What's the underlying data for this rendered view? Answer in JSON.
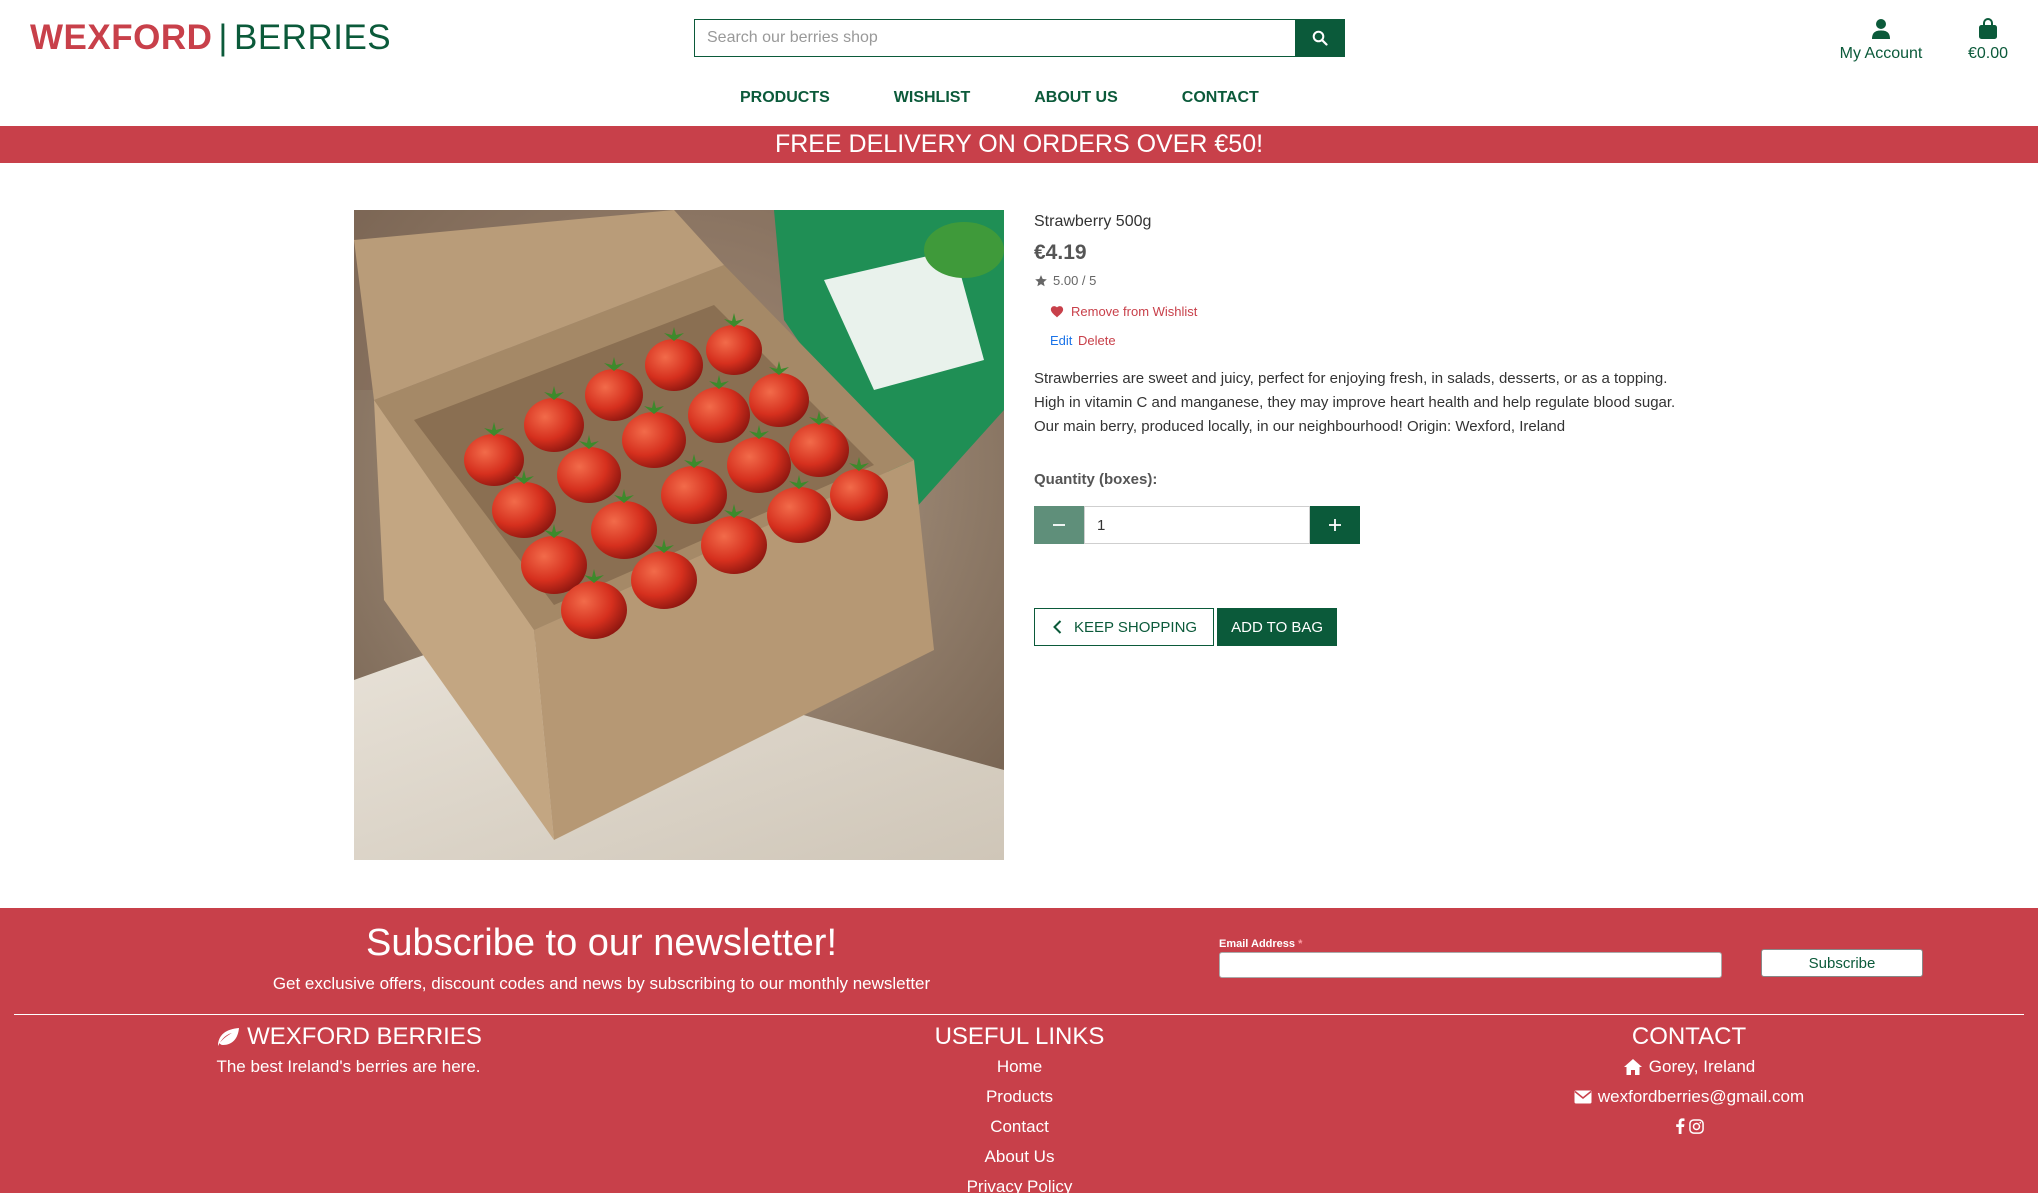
{
  "brand": {
    "name_part1": "WEXFORD",
    "separator": "|",
    "name_part2": "BERRIES",
    "accent_red": "#c8404a",
    "accent_green": "#0b5a3a"
  },
  "search": {
    "placeholder": "Search our berries shop",
    "icon": "search-icon"
  },
  "header": {
    "account_label": "My Account",
    "account_icon": "user-icon",
    "bag_total": "€0.00",
    "bag_icon": "shopping-bag-icon"
  },
  "nav": {
    "items": [
      "PRODUCTS",
      "WISHLIST",
      "ABOUT US",
      "CONTACT"
    ]
  },
  "banner": {
    "text": "FREE DELIVERY ON ORDERS OVER €50!"
  },
  "product": {
    "name": "Strawberry 500g",
    "price": "€4.19",
    "rating": "5.00 / 5",
    "wishlist_label": "Remove from Wishlist",
    "edit_label": "Edit",
    "delete_label": "Delete",
    "description": "Strawberries are sweet and juicy, perfect for enjoying fresh, in salads, desserts, or as a topping. High in vitamin C and manganese, they may improve heart health and help regulate blood sugar. Our main berry, produced locally, in our neighbourhood! Origin: Wexford, Ireland",
    "quantity_label": "Quantity (boxes):",
    "quantity_value": "1",
    "keep_shopping_label": "KEEP SHOPPING",
    "add_to_bag_label": "ADD TO BAG"
  },
  "newsletter": {
    "title": "Subscribe to our newsletter!",
    "subtitle": "Get exclusive offers, discount codes and news by subscribing to our monthly newsletter",
    "email_label": "Email Address",
    "required_mark": "*",
    "subscribe_label": "Subscribe"
  },
  "footer": {
    "brand_heading": "WEXFORD BERRIES",
    "brand_tagline": "The best Ireland's berries are here.",
    "links_heading": "USEFUL LINKS",
    "links": [
      "Home",
      "Products",
      "Contact",
      "About Us",
      "Privacy Policy"
    ],
    "contact_heading": "CONTACT",
    "location": "Gorey, Ireland",
    "email": "wexfordberries@gmail.com"
  }
}
